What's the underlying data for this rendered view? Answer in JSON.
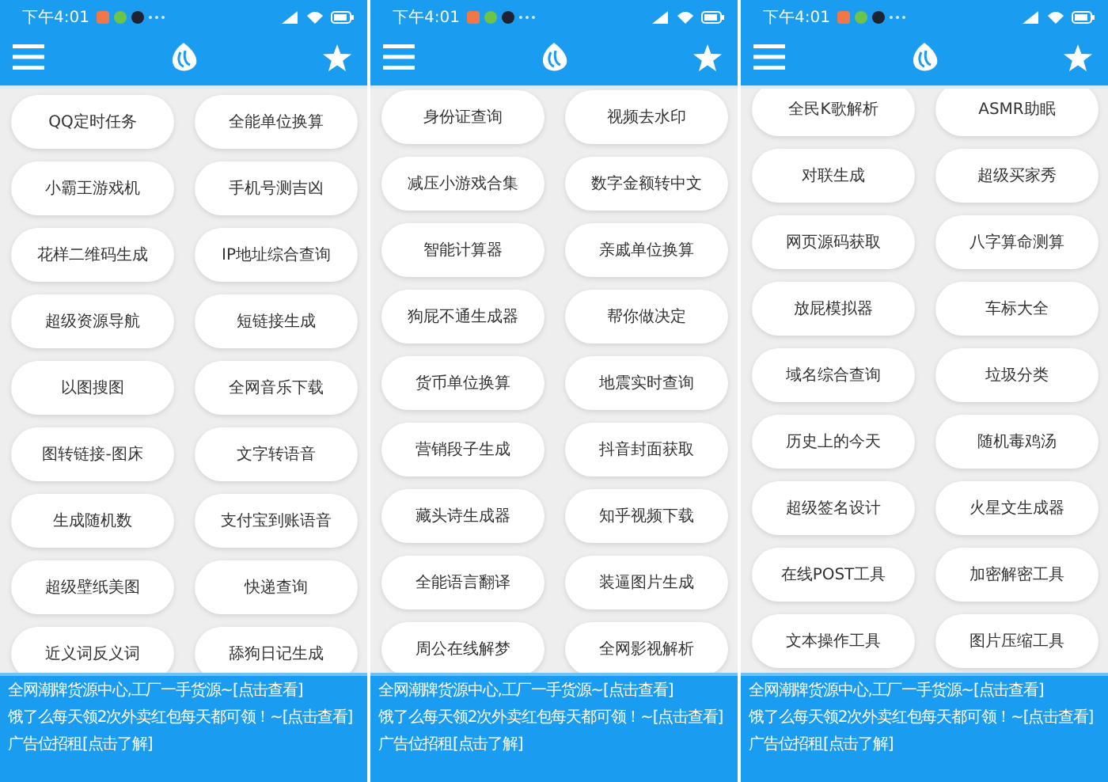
{
  "panels": [
    {
      "status_bar": {
        "time": "下午4:01"
      },
      "tools": [
        "QQ定时任务",
        "全能单位换算",
        "小霸王游戏机",
        "手机号测吉凶",
        "花样二维码生成",
        "IP地址综合查询",
        "超级资源导航",
        "短链接生成",
        "以图搜图",
        "全网音乐下载",
        "图转链接-图床",
        "文字转语音",
        "生成随机数",
        "支付宝到账语音",
        "超级壁纸美图",
        "快递查询",
        "近义词反义词",
        "舔狗日记生成"
      ],
      "banner": [
        "全网潮牌货源中心,工厂一手货源~[点击查看]",
        "饿了么每天领2次外卖红包每天都可领！~[点击查看]",
        "广告位招租[点击了解]"
      ]
    },
    {
      "status_bar": {
        "time": "下午4:01"
      },
      "tools": [
        "身份证查询",
        "视频去水印",
        "减压小游戏合集",
        "数字金额转中文",
        "智能计算器",
        "亲戚单位换算",
        "狗屁不通生成器",
        "帮你做决定",
        "货币单位换算",
        "地震实时查询",
        "营销段子生成",
        "抖音封面获取",
        "藏头诗生成器",
        "知乎视频下载",
        "全能语言翻译",
        "装逼图片生成",
        "周公在线解梦",
        "全网影视解析"
      ],
      "banner": [
        "全网潮牌货源中心,工厂一手货源~[点击查看]",
        "饿了么每天领2次外卖红包每天都可领！~[点击查看]",
        "广告位招租[点击了解]"
      ]
    },
    {
      "status_bar": {
        "time": "下午4:01"
      },
      "tools": [
        "全民K歌解析",
        "ASMR助眠",
        "对联生成",
        "超级买家秀",
        "网页源码获取",
        "八字算命测算",
        "放屁模拟器",
        "车标大全",
        "域名综合查询",
        "垃圾分类",
        "历史上的今天",
        "随机毒鸡汤",
        "超级签名设计",
        "火星文生成器",
        "在线POST工具",
        "加密解密工具",
        "文本操作工具",
        "图片压缩工具"
      ],
      "banner": [
        "全网潮牌货源中心,工厂一手货源~[点击查看]",
        "饿了么每天领2次外卖红包每天都可领！~[点击查看]",
        "广告位招租[点击了解]"
      ]
    }
  ]
}
